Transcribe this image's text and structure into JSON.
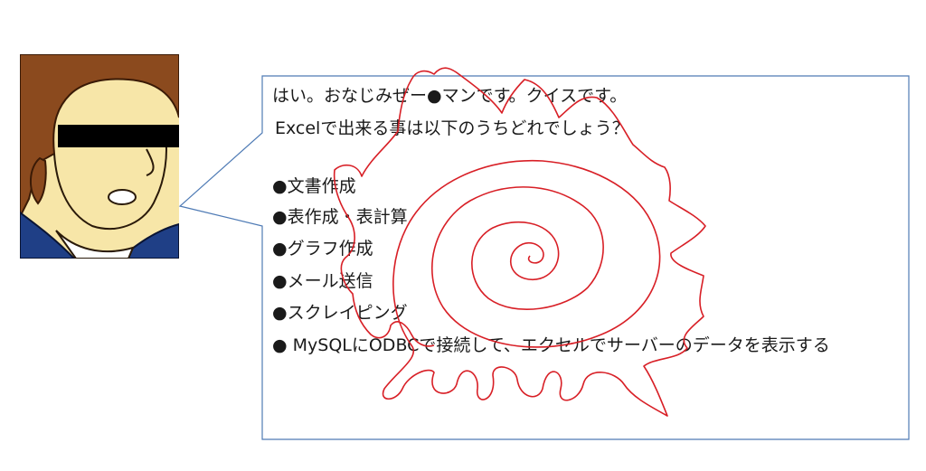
{
  "speech": {
    "line1": "はい。おなじみぜー●マンです。クイスです。",
    "line2": "Excelで出来る事は以下のうちどれでしょう？"
  },
  "options": [
    "●文書作成",
    "●表作成・表計算",
    "●グラフ作成",
    "●メール送信",
    "●スクレイピング",
    "● MySQLにODBCで接続して、エクセルでサーバーのデータを表示する"
  ],
  "colors": {
    "bubble_border": "#4f7bb5",
    "scribble": "#d81f26",
    "hair": "#8b4a1e",
    "skin": "#f7e6a8",
    "suit": "#1f3f86",
    "censor_bar": "#000000"
  }
}
